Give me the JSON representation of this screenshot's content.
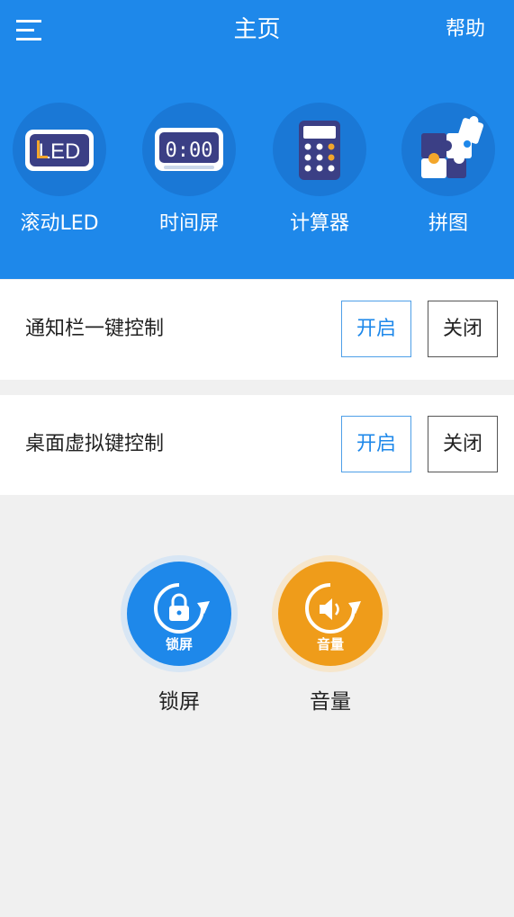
{
  "header": {
    "title": "主页",
    "help_label": "帮助",
    "menu_icon": "hamburger-menu-icon"
  },
  "features": [
    {
      "label": "滚动LED",
      "icon": "led-sign-icon",
      "icon_text": "LED"
    },
    {
      "label": "时间屏",
      "icon": "digital-clock-icon",
      "icon_text": "0:00"
    },
    {
      "label": "计算器",
      "icon": "calculator-icon"
    },
    {
      "label": "拼图",
      "icon": "puzzle-icon"
    }
  ],
  "controls": [
    {
      "label": "通知栏一键控制",
      "on_label": "开启",
      "off_label": "关闭"
    },
    {
      "label": "桌面虚拟键控制",
      "on_label": "开启",
      "off_label": "关闭"
    }
  ],
  "shortcuts": [
    {
      "label": "锁屏",
      "inner_label": "锁屏",
      "icon": "lock-rotate-icon"
    },
    {
      "label": "音量",
      "inner_label": "音量",
      "icon": "volume-rotate-icon"
    }
  ],
  "colors": {
    "primary": "#1e88ea",
    "lock_button": "#1e88ea",
    "volume_button": "#ef9c1a",
    "background": "#f0f0f0"
  }
}
